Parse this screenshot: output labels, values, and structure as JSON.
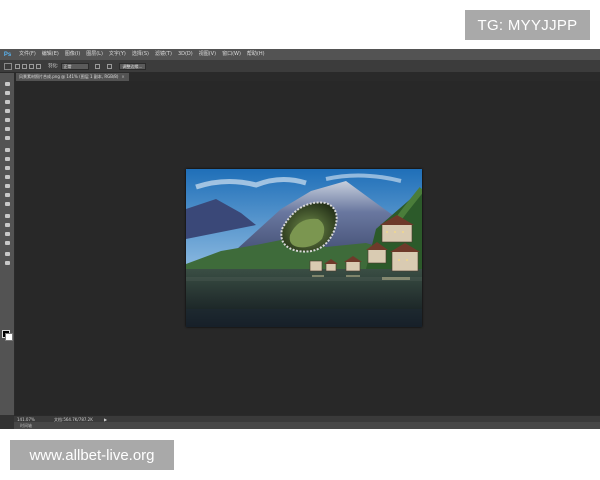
{
  "watermarks": {
    "top_right": "TG: MYYJJPP",
    "bottom_left": "www.allbet-live.org"
  },
  "app": {
    "logo": "Ps"
  },
  "menubar": {
    "items": [
      "文件(F)",
      "编辑(E)",
      "图像(I)",
      "图层(L)",
      "文字(Y)",
      "选择(S)",
      "滤镜(T)",
      "3D(D)",
      "视图(V)",
      "窗口(W)",
      "帮助(H)"
    ]
  },
  "options_bar": {
    "feather_label": "羽化:",
    "style_value": "正常",
    "refine_edge_button": "调整边缘..."
  },
  "document_tab": {
    "label": "风景素材照片合成.png @ 141% (图层 1 副本, RGB/8)",
    "close": "×"
  },
  "status_bar": {
    "zoom": "141.07%",
    "doc_size": "文档:564.7K/787.2K",
    "arrow": "▶"
  },
  "bottom_panel": {
    "label": "时间轴"
  },
  "colors": {
    "ps_blue": "#59b4f0",
    "workspace": "#282828",
    "panel": "#535353"
  }
}
